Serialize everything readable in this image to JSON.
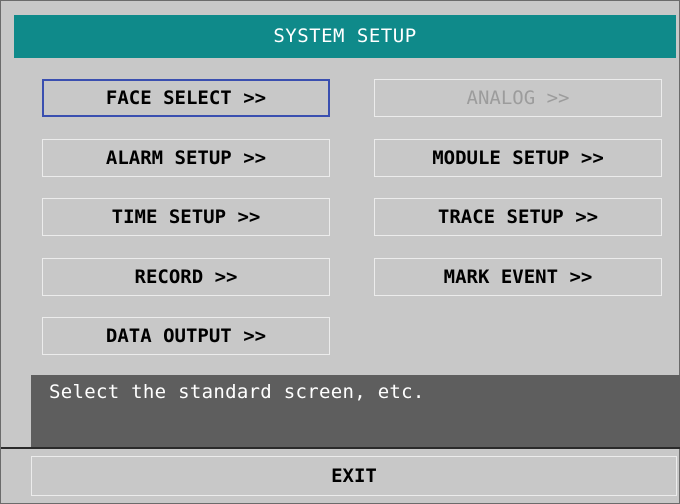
{
  "title": "SYSTEM SETUP",
  "buttons": {
    "face_select": "FACE SELECT >>",
    "analog": "ANALOG >>",
    "alarm_setup": "ALARM SETUP >>",
    "module_setup": "MODULE SETUP >>",
    "time_setup": "TIME SETUP >>",
    "trace_setup": "TRACE SETUP >>",
    "record": "RECORD >>",
    "mark_event": "MARK EVENT >>",
    "data_output": "DATA OUTPUT >>"
  },
  "status_text": "Select the standard screen, etc.",
  "exit_label": "EXIT",
  "colors": {
    "title_bar": "#0f8a8a",
    "selection_border": "#3a4fb0",
    "status_bg": "#5e5e5e",
    "panel_bg": "#c8c8c8"
  }
}
